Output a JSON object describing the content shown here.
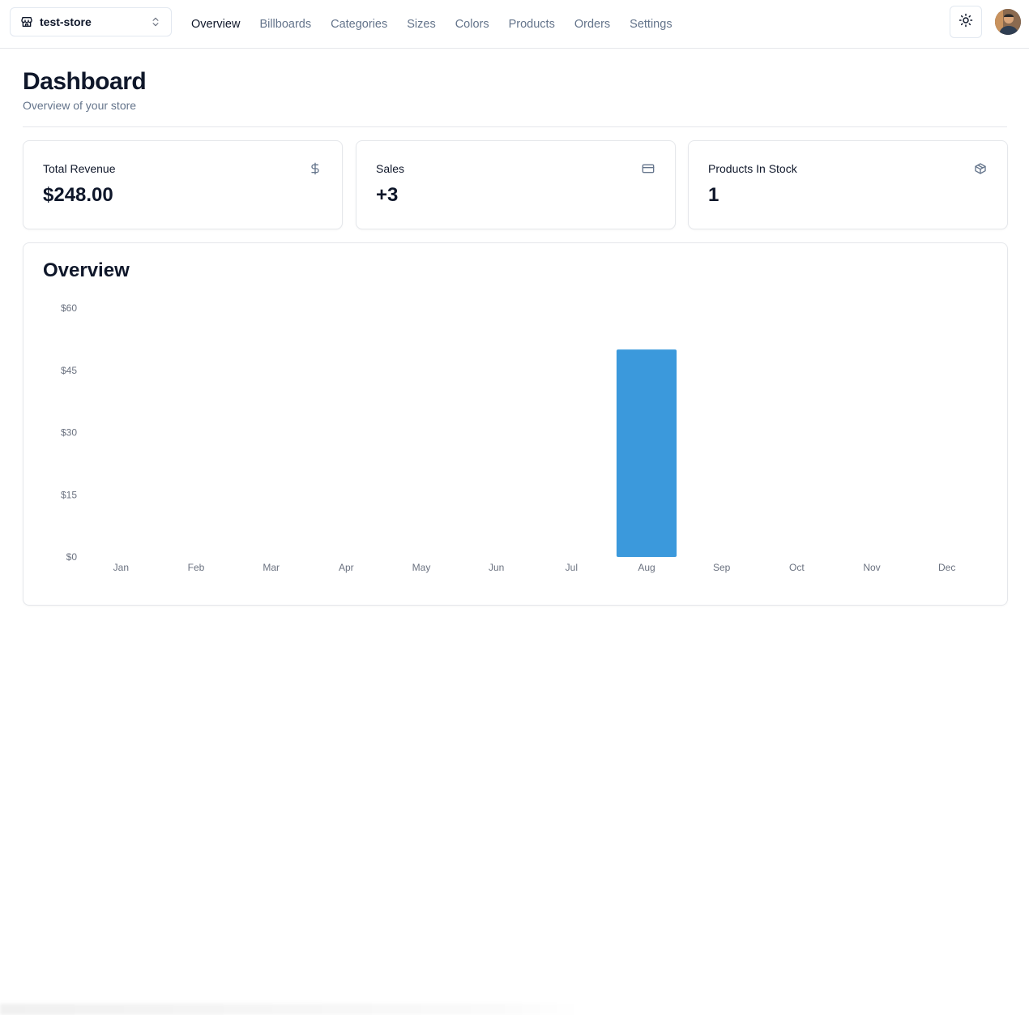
{
  "store_switcher": {
    "name": "test-store",
    "icon": "store-icon",
    "chevron_icon": "chevrons-up-down-icon"
  },
  "nav": {
    "items": [
      {
        "label": "Overview",
        "active": true
      },
      {
        "label": "Billboards",
        "active": false
      },
      {
        "label": "Categories",
        "active": false
      },
      {
        "label": "Sizes",
        "active": false
      },
      {
        "label": "Colors",
        "active": false
      },
      {
        "label": "Products",
        "active": false
      },
      {
        "label": "Orders",
        "active": false
      },
      {
        "label": "Settings",
        "active": false
      }
    ]
  },
  "header": {
    "title": "Dashboard",
    "subtitle": "Overview of your store"
  },
  "cards": [
    {
      "label": "Total Revenue",
      "value": "$248.00",
      "icon": "dollar-sign-icon"
    },
    {
      "label": "Sales",
      "value": "+3",
      "icon": "credit-card-icon"
    },
    {
      "label": "Products In Stock",
      "value": "1",
      "icon": "package-icon"
    }
  ],
  "overview": {
    "title": "Overview"
  },
  "colors": {
    "bar": "#3b99dc",
    "text_muted": "#64748b",
    "border": "#e5e7eb"
  },
  "chart_data": {
    "type": "bar",
    "categories": [
      "Jan",
      "Feb",
      "Mar",
      "Apr",
      "May",
      "Jun",
      "Jul",
      "Aug",
      "Sep",
      "Oct",
      "Nov",
      "Dec"
    ],
    "values": [
      0,
      0,
      0,
      0,
      0,
      0,
      0,
      50,
      0,
      0,
      0,
      0
    ],
    "y_ticks": [
      "$0",
      "$15",
      "$30",
      "$45",
      "$60"
    ],
    "ylim": [
      0,
      60
    ],
    "title": "Overview",
    "xlabel": "",
    "ylabel": "",
    "grid": false
  }
}
